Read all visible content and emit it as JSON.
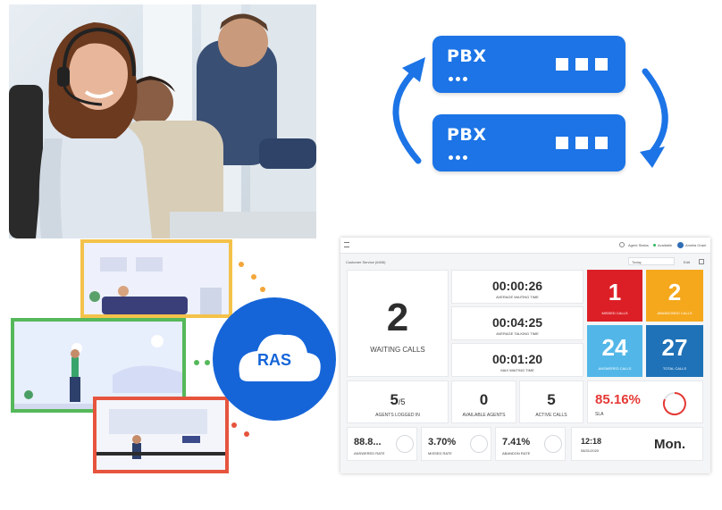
{
  "pbx": {
    "server_label": "PBX"
  },
  "ras": {
    "logo_text": "RAS"
  },
  "dashboard": {
    "menu_icon": "hamburger-icon",
    "help_icon": "question-icon",
    "agent_status_label": "Agent Status",
    "available_label": "Available",
    "user_name": "Amelia Grant",
    "queue_title": "Customer Service (6406)",
    "range_selected": "Today",
    "edit_label": "Edit",
    "waiting_calls": {
      "value": "2",
      "label": "WAITING CALLS"
    },
    "times": [
      {
        "value": "00:00:26",
        "label": "AVERAGE WAITING TIME"
      },
      {
        "value": "00:04:25",
        "label": "AVERAGE TALKING TIME"
      },
      {
        "value": "00:01:20",
        "label": "MAX WAITING TIME"
      }
    ],
    "tiles": [
      {
        "value": "1",
        "label": "MISSED CALLS",
        "color": "#dc1f26"
      },
      {
        "value": "2",
        "label": "ABANDONED CALLS",
        "color": "#f5a81c"
      },
      {
        "value": "24",
        "label": "ANSWERED CALLS",
        "color": "#52b7e8"
      },
      {
        "value": "27",
        "label": "TOTAL CALLS",
        "color": "#1f72b8"
      }
    ],
    "agents_logged_in": {
      "value": "5",
      "total": "/5",
      "label": "AGENTS LOGGED IN"
    },
    "available_agents": {
      "value": "0",
      "label": "AVAILABLE AGENTS"
    },
    "active_calls": {
      "value": "5",
      "label": "ACTIVE CALLS"
    },
    "sla": {
      "value": "85.16%",
      "label": "SLA",
      "color": "#e53935"
    },
    "answered_rate": {
      "value": "88.8...",
      "label": "ANSWERED RATE"
    },
    "missed_rate": {
      "value": "3.70%",
      "label": "MISSED RATE"
    },
    "abandon_rate": {
      "value": "7.41%",
      "label": "ABANDON RATE"
    },
    "clock": {
      "time": "12:18",
      "date": "08/31/2020",
      "day": "Mon."
    }
  }
}
